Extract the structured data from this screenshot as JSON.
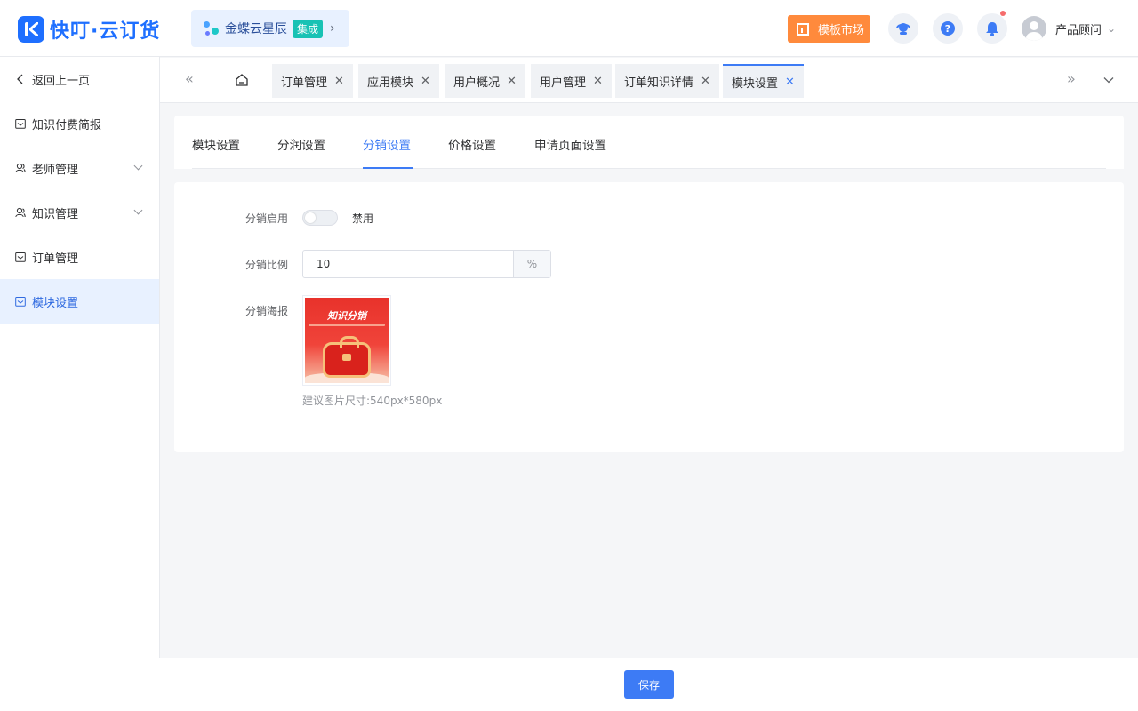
{
  "header": {
    "logo_text": "快叮·云订货",
    "integration": {
      "name": "金蝶云星辰",
      "badge": "集成"
    },
    "template_button": "模板市场",
    "user_name": "产品顾问"
  },
  "sidebar": {
    "back": "返回上一页",
    "items": [
      {
        "label": "知识付费简报"
      },
      {
        "label": "老师管理"
      },
      {
        "label": "知识管理"
      },
      {
        "label": "订单管理"
      },
      {
        "label": "模块设置"
      }
    ]
  },
  "tabs": [
    {
      "label": "订单管理"
    },
    {
      "label": "应用模块"
    },
    {
      "label": "用户概况"
    },
    {
      "label": "用户管理"
    },
    {
      "label": "订单知识详情"
    },
    {
      "label": "模块设置"
    }
  ],
  "subtabs": [
    {
      "label": "模块设置"
    },
    {
      "label": "分润设置"
    },
    {
      "label": "分销设置"
    },
    {
      "label": "价格设置"
    },
    {
      "label": "申请页面设置"
    }
  ],
  "form": {
    "enable_label": "分销启用",
    "enable_state": "禁用",
    "ratio_label": "分销比例",
    "ratio_value": "10",
    "ratio_unit": "%",
    "poster_label": "分销海报",
    "poster_title": "知识分销",
    "poster_hint": "建议图片尺寸:540px*580px"
  },
  "footer": {
    "save": "保存"
  },
  "colors": {
    "primary": "#3d7bf5",
    "brand": "#1e6fff",
    "template": "#ff8a3c"
  }
}
